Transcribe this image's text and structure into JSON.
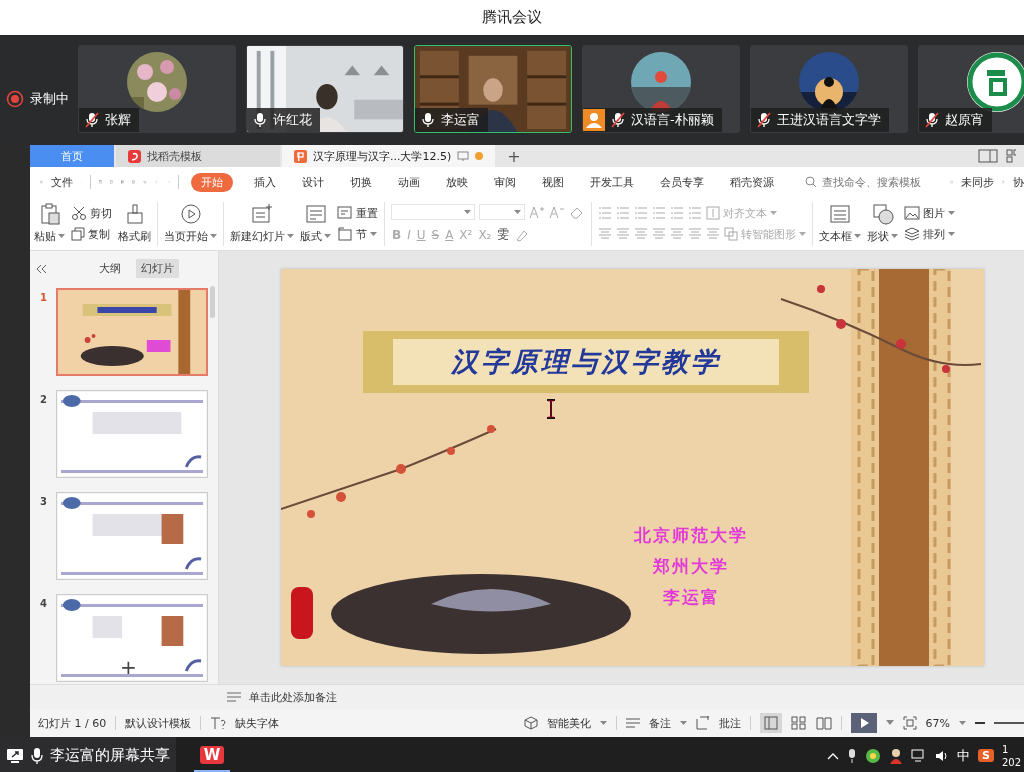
{
  "meeting": {
    "title": "腾讯会议",
    "recording": "录制中"
  },
  "participants": [
    {
      "name": "张辉",
      "kind": "avatar",
      "muted": true,
      "selected": false,
      "person_badge": false
    },
    {
      "name": "许红花",
      "kind": "video",
      "muted": false,
      "selected": false,
      "person_badge": false
    },
    {
      "name": "李运富",
      "kind": "video",
      "muted": false,
      "selected": true,
      "person_badge": false
    },
    {
      "name": "汉语言-朴丽颖",
      "kind": "avatar",
      "muted": true,
      "selected": false,
      "person_badge": true
    },
    {
      "name": "王进汉语言文字学",
      "kind": "avatar",
      "muted": true,
      "selected": false,
      "person_badge": false
    },
    {
      "name": "赵原宵",
      "kind": "avatar",
      "muted": true,
      "selected": false,
      "person_badge": false
    }
  ],
  "tabs": [
    {
      "label": "首页",
      "kind": "home",
      "selected": false
    },
    {
      "label": "找稻壳模板",
      "kind": "template",
      "selected": false
    },
    {
      "label": "汉字原理与汉字...大学12.5)",
      "kind": "document",
      "selected": true,
      "modified": true
    }
  ],
  "new_tab": "+",
  "menu": {
    "file": "文件",
    "tabs": [
      {
        "label": "开始",
        "selected": true
      },
      {
        "label": "插入",
        "selected": false
      },
      {
        "label": "设计",
        "selected": false
      },
      {
        "label": "切换",
        "selected": false
      },
      {
        "label": "动画",
        "selected": false
      },
      {
        "label": "放映",
        "selected": false
      },
      {
        "label": "审阅",
        "selected": false
      },
      {
        "label": "视图",
        "selected": false
      },
      {
        "label": "开发工具",
        "selected": false
      },
      {
        "label": "会员专享",
        "selected": false
      },
      {
        "label": "稻壳资源",
        "selected": false
      }
    ],
    "search": {
      "placeholder": "查找命令、搜索模板"
    },
    "sync": "未同步",
    "collab": "协"
  },
  "ribbon": {
    "paste": "粘贴",
    "cut": "剪切",
    "copy": "复制",
    "format_painter": "格式刷",
    "play_from_current": "当页开始",
    "new_slide": "新建幻灯片",
    "layout": "版式",
    "reset": "重置",
    "section": "节",
    "font_styles": [
      "B",
      "I",
      "U",
      "S",
      "A"
    ],
    "scripts": [
      "X²",
      "X₂"
    ],
    "phonetic": "雯",
    "align_text": {
      "label": "对齐文本",
      "disabled": true
    },
    "smart_art": {
      "label": "转智能图形",
      "disabled": true
    },
    "text_box": "文本框",
    "shape": "形状",
    "picture": "图片",
    "arrange": "排列"
  },
  "panel": {
    "tabs": [
      {
        "label": "大纲",
        "selected": false
      },
      {
        "label": "幻灯片",
        "selected": true
      }
    ],
    "thumbnails": [
      {
        "number": "1",
        "selected": true
      },
      {
        "number": "2",
        "selected": false
      },
      {
        "number": "3",
        "selected": false
      },
      {
        "number": "4",
        "selected": false
      }
    ],
    "add": "+"
  },
  "slide": {
    "title": "汉字原理与汉字教学",
    "lines": [
      "北京师范大学",
      "郑州大学",
      "李运富"
    ]
  },
  "notes": {
    "placeholder": "单击此处添加备注"
  },
  "status_bar": {
    "counter": "幻灯片 1 / 60",
    "template": "默认设计模板",
    "missing_fonts": "缺失字体",
    "beautify": "智能美化",
    "notes": "备注",
    "comments": "批注",
    "zoom": "67%"
  },
  "taskbar": {
    "share": "李运富的屏幕共享",
    "app_letter": "W",
    "ime": "中",
    "tray_app_letter": "S",
    "clock": [
      "1",
      "202"
    ]
  }
}
